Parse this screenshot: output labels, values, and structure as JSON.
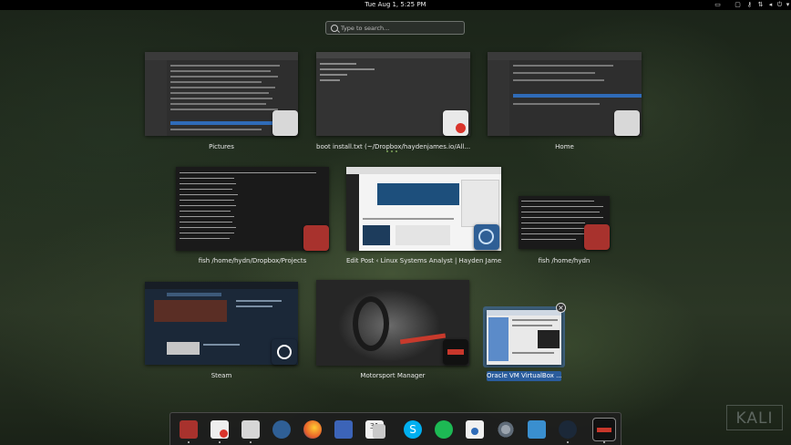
{
  "topbar": {
    "clock": "Tue Aug  1,  5:25 PM",
    "tray_icons": [
      "clipboard-icon",
      "screen-icon",
      "key-icon",
      "network-icon",
      "volume-icon",
      "power-icon",
      "chevron-down-icon"
    ]
  },
  "search": {
    "placeholder": "Type to search..."
  },
  "windows": [
    {
      "caption": "Pictures",
      "app_icon": "folder-icon"
    },
    {
      "caption": "boot install.txt (~/Dropbox/haydenjames.io/All...optim...",
      "app_icon": "text-editor-icon"
    },
    {
      "caption": "Home",
      "app_icon": "folder-icon"
    },
    {
      "caption": "fish  /home/hydn/Dropbox/Projects",
      "app_icon": "terminal-icon"
    },
    {
      "caption": "Edit Post ‹ Linux Systems Analyst | Hayden James —...",
      "app_icon": "browser-icon"
    },
    {
      "caption": "fish  /home/hydn",
      "app_icon": "terminal-icon"
    },
    {
      "caption": "Steam",
      "app_icon": "steam-icon"
    },
    {
      "caption": "Motorsport Manager",
      "app_icon": "motorsport-icon"
    },
    {
      "caption": "Oracle VM VirtualBox ...",
      "app_icon": "virtualbox-icon",
      "selected": true
    }
  ],
  "dock": {
    "apps": [
      "terminal",
      "text-editor",
      "files",
      "browser-web",
      "firefox",
      "contacts",
      "calendar",
      "tasks",
      "skype",
      "spotify",
      "software",
      "settings",
      "system-monitor",
      "steam",
      "motorsport-manager"
    ]
  },
  "watermark": "KALI",
  "colors": {
    "accent": "#2a5c9c",
    "topbar": "#000000",
    "dock_bg": "#1e1e1e"
  }
}
